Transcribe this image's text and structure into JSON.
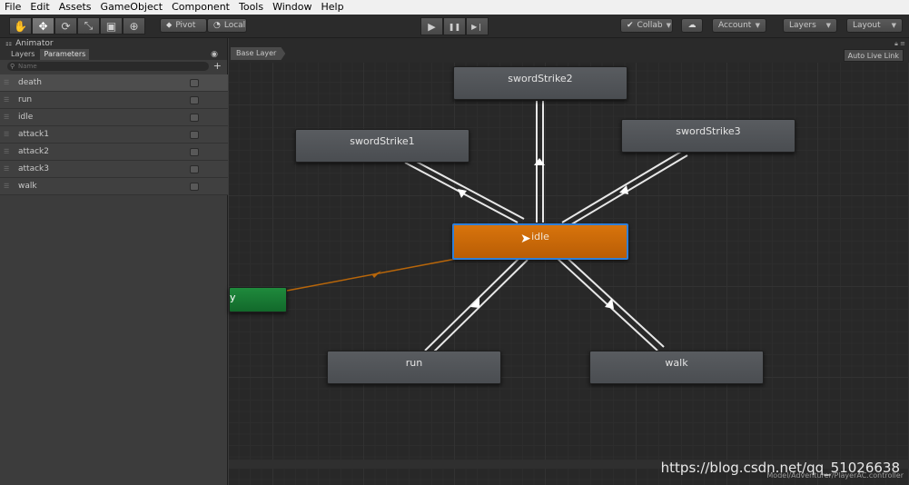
{
  "menu": [
    "File",
    "Edit",
    "Assets",
    "GameObject",
    "Component",
    "Tools",
    "Window",
    "Help"
  ],
  "toolbar": {
    "tools": [
      {
        "name": "hand-tool-icon",
        "glyph": "✋"
      },
      {
        "name": "move-tool-icon",
        "glyph": "✥"
      },
      {
        "name": "rotate-tool-icon",
        "glyph": "⟳"
      },
      {
        "name": "scale-tool-icon",
        "glyph": "⤡"
      },
      {
        "name": "rect-tool-icon",
        "glyph": "▣"
      },
      {
        "name": "transform-tool-icon",
        "glyph": "⊕"
      }
    ],
    "pivot_label": "Pivot",
    "local_label": "Local",
    "play_glyph": "▶",
    "pause_glyph": "❚❚",
    "step_glyph": "▶❘",
    "collab_label": "Collab",
    "account_label": "Account",
    "layers_label": "Layers",
    "layout_label": "Layout"
  },
  "animator": {
    "title": "Animator",
    "tab_layers": "Layers",
    "tab_parameters": "Parameters",
    "search_placeholder": "Name",
    "params": [
      "death",
      "run",
      "idle",
      "attack1",
      "attack2",
      "attack3",
      "walk"
    ],
    "selected_param": "death"
  },
  "graph": {
    "breadcrumb": "Base Layer",
    "auto_live_link": "Auto Live Link",
    "states": {
      "swordStrike2": "swordStrike2",
      "swordStrike1": "swordStrike1",
      "swordStrike3": "swordStrike3",
      "idle": "idle",
      "run": "run",
      "walk": "walk",
      "entry": "y"
    },
    "path": "Model/Adventurer/PlayerAC.controller",
    "default_state": "idle"
  },
  "watermark": "https://blog.csdn.net/qq_51026638",
  "colors": {
    "default_state": "#c86a08",
    "selected_outline": "#2f7fd8",
    "entry_state": "#1a7a34",
    "default_transition": "#b8660a",
    "transition": "#e8e8e8"
  }
}
